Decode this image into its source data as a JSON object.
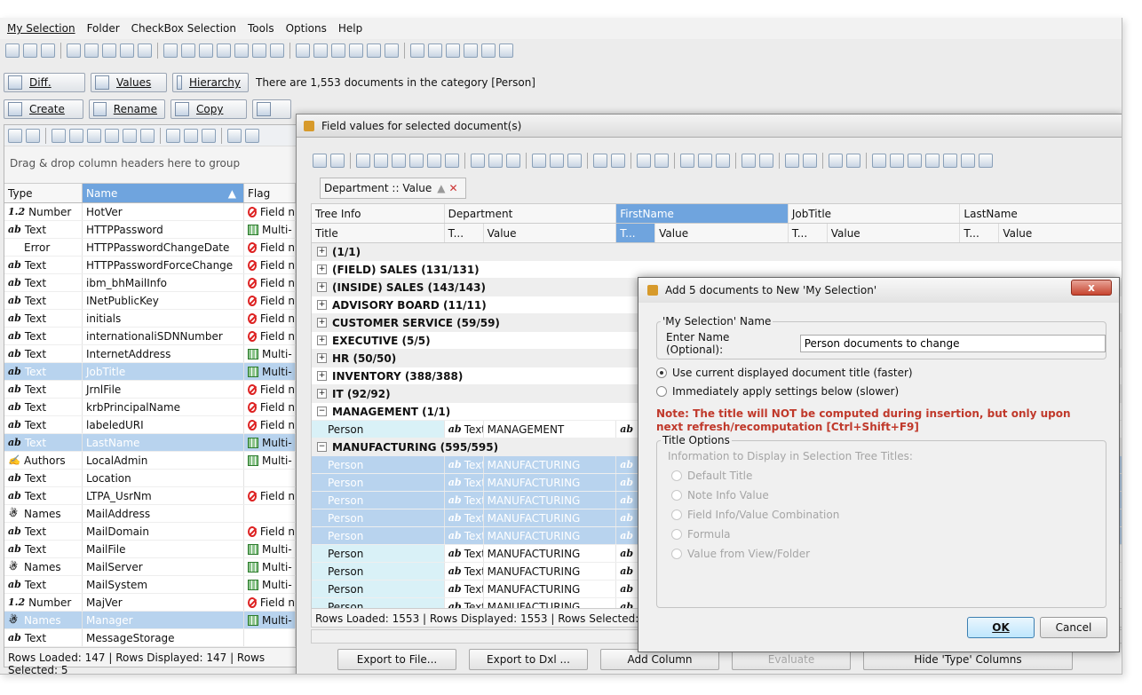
{
  "menu": [
    "My Selection",
    "Folder",
    "CheckBox Selection",
    "Tools",
    "Options",
    "Help"
  ],
  "command_bar": {
    "diff": "Diff.",
    "values": "Values",
    "hierarchy": "Hierarchy",
    "info": "There are 1,553 documents in the category [Person]"
  },
  "action_bar": {
    "create": "Create",
    "rename": "Rename",
    "copy": "Copy"
  },
  "left_panel": {
    "drag_hint": "Drag & drop column headers here to group",
    "columns": [
      "Type",
      "Name",
      "Flag"
    ],
    "rows": [
      {
        "type_icon": "1.2",
        "type": "Number",
        "name": "HotVer",
        "flag_icon": "forbid",
        "flag": "Field n"
      },
      {
        "type_icon": "ab",
        "type": "Text",
        "name": "HTTPPassword",
        "flag_icon": "multi",
        "flag": "Multi-"
      },
      {
        "type_icon": "",
        "type": "Error",
        "name": "HTTPPasswordChangeDate",
        "flag_icon": "forbid",
        "flag": "Field n"
      },
      {
        "type_icon": "ab",
        "type": "Text",
        "name": "HTTPPasswordForceChange",
        "flag_icon": "forbid",
        "flag": "Field n"
      },
      {
        "type_icon": "ab",
        "type": "Text",
        "name": "ibm_bhMailInfo",
        "flag_icon": "forbid",
        "flag": "Field n"
      },
      {
        "type_icon": "ab",
        "type": "Text",
        "name": "INetPublicKey",
        "flag_icon": "forbid",
        "flag": "Field n"
      },
      {
        "type_icon": "ab",
        "type": "Text",
        "name": "initials",
        "flag_icon": "forbid",
        "flag": "Field n"
      },
      {
        "type_icon": "ab",
        "type": "Text",
        "name": "internationaliSDNNumber",
        "flag_icon": "forbid",
        "flag": "Field n"
      },
      {
        "type_icon": "ab",
        "type": "Text",
        "name": "InternetAddress",
        "flag_icon": "multi",
        "flag": "Multi-"
      },
      {
        "type_icon": "ab",
        "type": "Text",
        "name": "JobTitle",
        "flag_icon": "multi",
        "flag": "Multi-",
        "selected": true
      },
      {
        "type_icon": "ab",
        "type": "Text",
        "name": "JrnlFile",
        "flag_icon": "forbid",
        "flag": "Field n"
      },
      {
        "type_icon": "ab",
        "type": "Text",
        "name": "krbPrincipalName",
        "flag_icon": "forbid",
        "flag": "Field n"
      },
      {
        "type_icon": "ab",
        "type": "Text",
        "name": "labeledURI",
        "flag_icon": "forbid",
        "flag": "Field n"
      },
      {
        "type_icon": "ab",
        "type": "Text",
        "name": "LastName",
        "flag_icon": "multi",
        "flag": "Multi-",
        "selected": true
      },
      {
        "type_icon": "✍",
        "type": "Authors",
        "name": "LocalAdmin",
        "flag_icon": "multi",
        "flag": "Multi-"
      },
      {
        "type_icon": "ab",
        "type": "Text",
        "name": "Location",
        "flag_icon": "",
        "flag": ""
      },
      {
        "type_icon": "ab",
        "type": "Text",
        "name": "LTPA_UsrNm",
        "flag_icon": "forbid",
        "flag": "Field n"
      },
      {
        "type_icon": "☃",
        "type": "Names",
        "name": "MailAddress",
        "flag_icon": "",
        "flag": ""
      },
      {
        "type_icon": "ab",
        "type": "Text",
        "name": "MailDomain",
        "flag_icon": "forbid",
        "flag": "Field n"
      },
      {
        "type_icon": "ab",
        "type": "Text",
        "name": "MailFile",
        "flag_icon": "multi",
        "flag": "Multi-"
      },
      {
        "type_icon": "☃",
        "type": "Names",
        "name": "MailServer",
        "flag_icon": "multi",
        "flag": "Multi-"
      },
      {
        "type_icon": "ab",
        "type": "Text",
        "name": "MailSystem",
        "flag_icon": "multi",
        "flag": "Multi-"
      },
      {
        "type_icon": "1.2",
        "type": "Number",
        "name": "MajVer",
        "flag_icon": "forbid",
        "flag": "Field n"
      },
      {
        "type_icon": "☃",
        "type": "Names",
        "name": "Manager",
        "flag_icon": "multi",
        "flag": "Multi-",
        "selected": true
      },
      {
        "type_icon": "ab",
        "type": "Text",
        "name": "MessageStorage",
        "flag_icon": "",
        "flag": ""
      }
    ],
    "status": "Rows Loaded: 147  |  Rows Displayed: 147  |  Rows Selected: 5"
  },
  "field_values": {
    "title": "Field values for selected document(s)",
    "group_chip": "Department :: Value",
    "columns": [
      "Tree Info",
      "Department",
      "FirstName",
      "JobTitle",
      "LastName"
    ],
    "sub": [
      "Title",
      "T...",
      "Value",
      "T...",
      "Value",
      "T...",
      "Value",
      "T...",
      "Value"
    ],
    "groups": [
      {
        "label": "(1/1)",
        "expanded": false
      },
      {
        "label": "(FIELD) SALES (131/131)",
        "expanded": false
      },
      {
        "label": "(INSIDE) SALES (143/143)",
        "expanded": false
      },
      {
        "label": "ADVISORY BOARD (11/11)",
        "expanded": false
      },
      {
        "label": "CUSTOMER SERVICE (59/59)",
        "expanded": false
      },
      {
        "label": "EXECUTIVE (5/5)",
        "expanded": false
      },
      {
        "label": "HR (50/50)",
        "expanded": false
      },
      {
        "label": "INVENTORY (388/388)",
        "expanded": false
      },
      {
        "label": "IT (92/92)",
        "expanded": false
      },
      {
        "label": "MANAGEMENT (1/1)",
        "expanded": true,
        "rows": [
          {
            "title": "Person",
            "type": "Text",
            "value": "MANAGEMENT",
            "sel": false
          }
        ]
      },
      {
        "label": "MANUFACTURING (595/595)",
        "expanded": true,
        "rows": [
          {
            "title": "Person",
            "type": "Text",
            "value": "MANUFACTURING",
            "sel": true
          },
          {
            "title": "Person",
            "type": "Text",
            "value": "MANUFACTURING",
            "sel": true
          },
          {
            "title": "Person",
            "type": "Text",
            "value": "MANUFACTURING",
            "sel": true
          },
          {
            "title": "Person",
            "type": "Text",
            "value": "MANUFACTURING",
            "sel": true
          },
          {
            "title": "Person",
            "type": "Text",
            "value": "MANUFACTURING",
            "sel": true
          },
          {
            "title": "Person",
            "type": "Text",
            "value": "MANUFACTURING",
            "sel": false
          },
          {
            "title": "Person",
            "type": "Text",
            "value": "MANUFACTURING",
            "sel": false
          },
          {
            "title": "Person",
            "type": "Text",
            "value": "MANUFACTURING",
            "sel": false
          },
          {
            "title": "Person",
            "type": "Text",
            "value": "MANUFACTURING",
            "sel": false
          }
        ]
      }
    ],
    "status": "Rows Loaded: 1553  |  Rows Displayed: 1553  |  Rows Selected: 5",
    "buttons": {
      "export_file": "Export to File...",
      "export_dxl": "Export to Dxl ...",
      "add_column": "Add Column",
      "evaluate": "Evaluate",
      "hide_type": "Hide 'Type' Columns"
    }
  },
  "dialog": {
    "title": "Add 5 documents to New 'My Selection'",
    "name_group": "'My Selection' Name",
    "name_label": "Enter Name (Optional):",
    "name_value": "Person documents to change",
    "radio_fast": "Use current displayed document title (faster)",
    "radio_slow": "Immediately apply settings below (slower)",
    "note": "Note: The title will NOT be computed during insertion, but only upon next refresh/recomputation [Ctrl+Shift+F9]",
    "title_options": "Title Options",
    "title_info": "Information to Display in Selection Tree Titles:",
    "options": [
      "Default Title",
      "Note Info Value",
      "Field Info/Value Combination",
      "Formula",
      "Value from View/Folder"
    ],
    "ok": "OK",
    "cancel": "Cancel",
    "close": "x"
  }
}
